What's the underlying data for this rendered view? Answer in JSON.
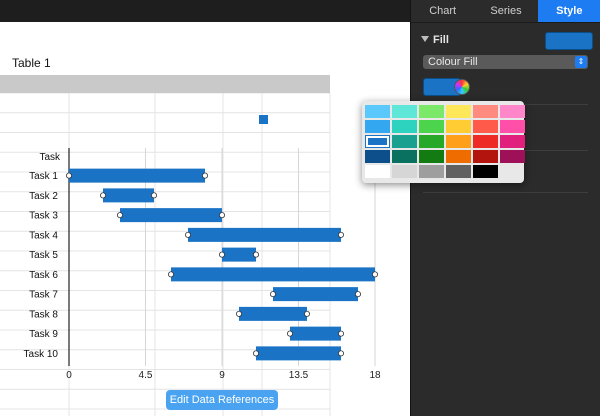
{
  "inspector": {
    "tabs": [
      {
        "label": "Chart",
        "active": false
      },
      {
        "label": "Series",
        "active": false
      },
      {
        "label": "Style",
        "active": true
      }
    ],
    "fill_section_label": "Fill",
    "fill_color": "#1a73c5",
    "fill_type": "Colour Fill",
    "colour_well": "#1a73c5"
  },
  "spreadsheet": {
    "table_title": "Table 1",
    "edit_button_label": "Edit Data References"
  },
  "palette": {
    "rows": [
      [
        "#5ac8fa",
        "#5ee6d8",
        "#7be86a",
        "#ffe75a",
        "#ff8a80",
        "#ff86c8"
      ],
      [
        "#33a8f0",
        "#2ed3c0",
        "#4cd44c",
        "#ffcc33",
        "#ff5a4a",
        "#ff4fa8"
      ],
      [
        "#1a73c5",
        "#1aa08f",
        "#28a828",
        "#ff9f1a",
        "#ee2a24",
        "#e0207c"
      ],
      [
        "#0d4f8a",
        "#0a7060",
        "#127c12",
        "#ef6c00",
        "#b3140e",
        "#9e1058"
      ],
      [
        "#ffffff",
        "#d6d6d6",
        "#9e9e9e",
        "#616161",
        "#000000",
        ""
      ]
    ],
    "selected": [
      2,
      0
    ]
  },
  "chart_data": {
    "type": "bar",
    "chart_subtype": "gantt",
    "categories": [
      "Task 1",
      "Task 2",
      "Task 3",
      "Task 4",
      "Task 5",
      "Task 6",
      "Task 7",
      "Task 8",
      "Task 9",
      "Task 10"
    ],
    "category_header": "Task",
    "start": [
      0,
      2,
      3,
      7,
      9,
      6,
      12,
      10,
      13,
      11
    ],
    "end": [
      8,
      5,
      9,
      16,
      11,
      18,
      17,
      14,
      16,
      16
    ],
    "xlim": [
      0,
      18
    ],
    "x_ticks": [
      "0",
      "4.5",
      "9",
      "13.5",
      "18"
    ],
    "x_tick_values": [
      0,
      4.5,
      9,
      13.5,
      18
    ],
    "bar_color": "#1a73c5",
    "legend_marker_color": "#1a73c5"
  }
}
